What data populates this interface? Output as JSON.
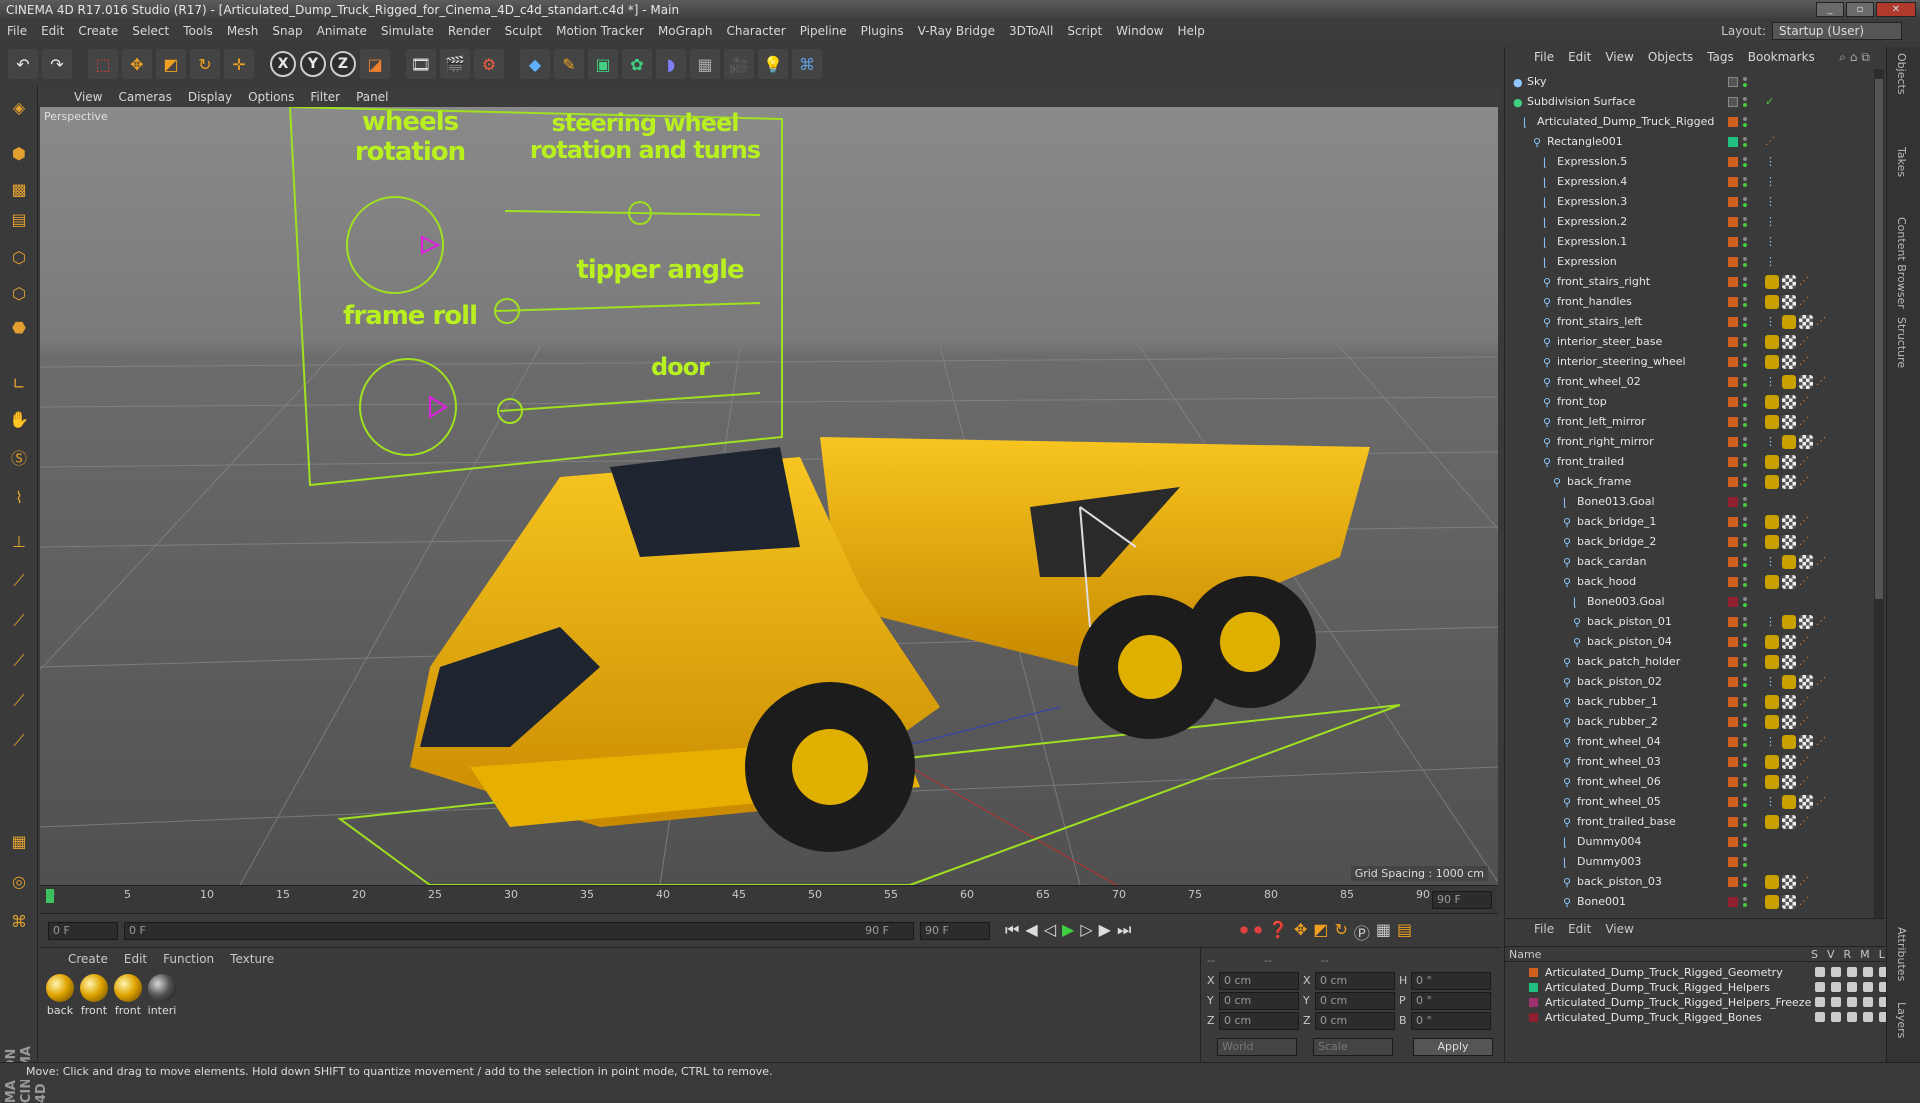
{
  "window": {
    "title": "CINEMA 4D R17.016 Studio (R17) - [Articulated_Dump_Truck_Rigged_for_Cinema_4D_c4d_standart.c4d *] - Main"
  },
  "menubar": [
    "File",
    "Edit",
    "Create",
    "Select",
    "Tools",
    "Mesh",
    "Snap",
    "Animate",
    "Simulate",
    "Render",
    "Sculpt",
    "Motion Tracker",
    "MoGraph",
    "Character",
    "Pipeline",
    "Plugins",
    "V-Ray Bridge",
    "3DToAll",
    "Script",
    "Window",
    "Help"
  ],
  "layout": {
    "label": "Layout:",
    "value": "Startup (User)"
  },
  "viewport": {
    "menu": [
      "View",
      "Cameras",
      "Display",
      "Options",
      "Filter",
      "Panel"
    ],
    "label": "Perspective",
    "grid_spacing": "Grid Spacing : 1000 cm",
    "hud": {
      "wheels": "wheels rotation",
      "steering": "steering wheel rotation and turns",
      "tipper": "tipper angle",
      "frame": "frame roll",
      "door": "door"
    }
  },
  "timeline": {
    "ticks": [
      "0",
      "5",
      "10",
      "15",
      "20",
      "25",
      "30",
      "35",
      "40",
      "45",
      "50",
      "55",
      "60",
      "65",
      "70",
      "75",
      "80",
      "85",
      "90"
    ],
    "end": "90 F"
  },
  "anim": {
    "start": "0 F",
    "current": "0 F",
    "end_field": "90 F",
    "end": "90 F"
  },
  "materials": {
    "menu": [
      "Create",
      "Edit",
      "Function",
      "Texture"
    ],
    "items": [
      "back",
      "front",
      "front",
      "interi"
    ]
  },
  "coords": {
    "rows": [
      {
        "axis": "X",
        "pos": "0 cm",
        "size_axis": "X",
        "size": "0 cm",
        "rot_axis": "H",
        "rot": "0 °"
      },
      {
        "axis": "Y",
        "pos": "0 cm",
        "size_axis": "Y",
        "size": "0 cm",
        "rot_axis": "P",
        "rot": "0 °"
      },
      {
        "axis": "Z",
        "pos": "0 cm",
        "size_axis": "Z",
        "size": "0 cm",
        "rot_axis": "B",
        "rot": "0 °"
      }
    ],
    "world": "World",
    "scale": "Scale",
    "apply": "Apply"
  },
  "objects": {
    "menu": [
      "File",
      "Edit",
      "View",
      "Objects",
      "Tags",
      "Bookmarks"
    ],
    "items": [
      {
        "name": "Sky"
      },
      {
        "name": "Subdivision Surface"
      },
      {
        "name": "Articulated_Dump_Truck_Rigged"
      },
      {
        "name": "Rectangle001"
      },
      {
        "name": "Expression.5"
      },
      {
        "name": "Expression.4"
      },
      {
        "name": "Expression.3"
      },
      {
        "name": "Expression.2"
      },
      {
        "name": "Expression.1"
      },
      {
        "name": "Expression"
      },
      {
        "name": "front_stairs_right"
      },
      {
        "name": "front_handles"
      },
      {
        "name": "front_stairs_left"
      },
      {
        "name": "interior_steer_base"
      },
      {
        "name": "interior_steering_wheel"
      },
      {
        "name": "front_wheel_02"
      },
      {
        "name": "front_top"
      },
      {
        "name": "front_left_mirror"
      },
      {
        "name": "front_right_mirror"
      },
      {
        "name": "front_trailed"
      },
      {
        "name": "back_frame"
      },
      {
        "name": "Bone013.Goal"
      },
      {
        "name": "back_bridge_1"
      },
      {
        "name": "back_bridge_2"
      },
      {
        "name": "back_cardan"
      },
      {
        "name": "back_hood"
      },
      {
        "name": "Bone003.Goal"
      },
      {
        "name": "back_piston_01"
      },
      {
        "name": "back_piston_04"
      },
      {
        "name": "back_patch_holder"
      },
      {
        "name": "back_piston_02"
      },
      {
        "name": "back_rubber_1"
      },
      {
        "name": "back_rubber_2"
      },
      {
        "name": "front_wheel_04"
      },
      {
        "name": "front_wheel_03"
      },
      {
        "name": "front_wheel_06"
      },
      {
        "name": "front_wheel_05"
      },
      {
        "name": "front_trailed_base"
      },
      {
        "name": "Dummy004"
      },
      {
        "name": "Dummy003"
      },
      {
        "name": "back_piston_03"
      },
      {
        "name": "Bone001"
      }
    ]
  },
  "layers": {
    "menu": [
      "File",
      "Edit",
      "View"
    ],
    "header": {
      "name": "Name",
      "cols": [
        "S",
        "V",
        "R",
        "M",
        "L"
      ]
    },
    "items": [
      {
        "name": "Articulated_Dump_Truck_Rigged_Geometry",
        "color": "#d06020"
      },
      {
        "name": "Articulated_Dump_Truck_Rigged_Helpers",
        "color": "#20c080"
      },
      {
        "name": "Articulated_Dump_Truck_Rigged_Helpers_Freeze",
        "color": "#a03070"
      },
      {
        "name": "Articulated_Dump_Truck_Rigged_Bones",
        "color": "#902030"
      }
    ]
  },
  "sidetabs": [
    "Objects",
    "Takes",
    "Content Browser",
    "Structure",
    "Attributes",
    "Layers"
  ],
  "status": "Move: Click and drag to move elements. Hold down SHIFT to quantize movement / add to the selection in point mode, CTRL to remove.",
  "colors": {
    "hud_green": "#b8f020",
    "truck_yellow": "#f0b000",
    "accent_orange": "#d06020"
  }
}
